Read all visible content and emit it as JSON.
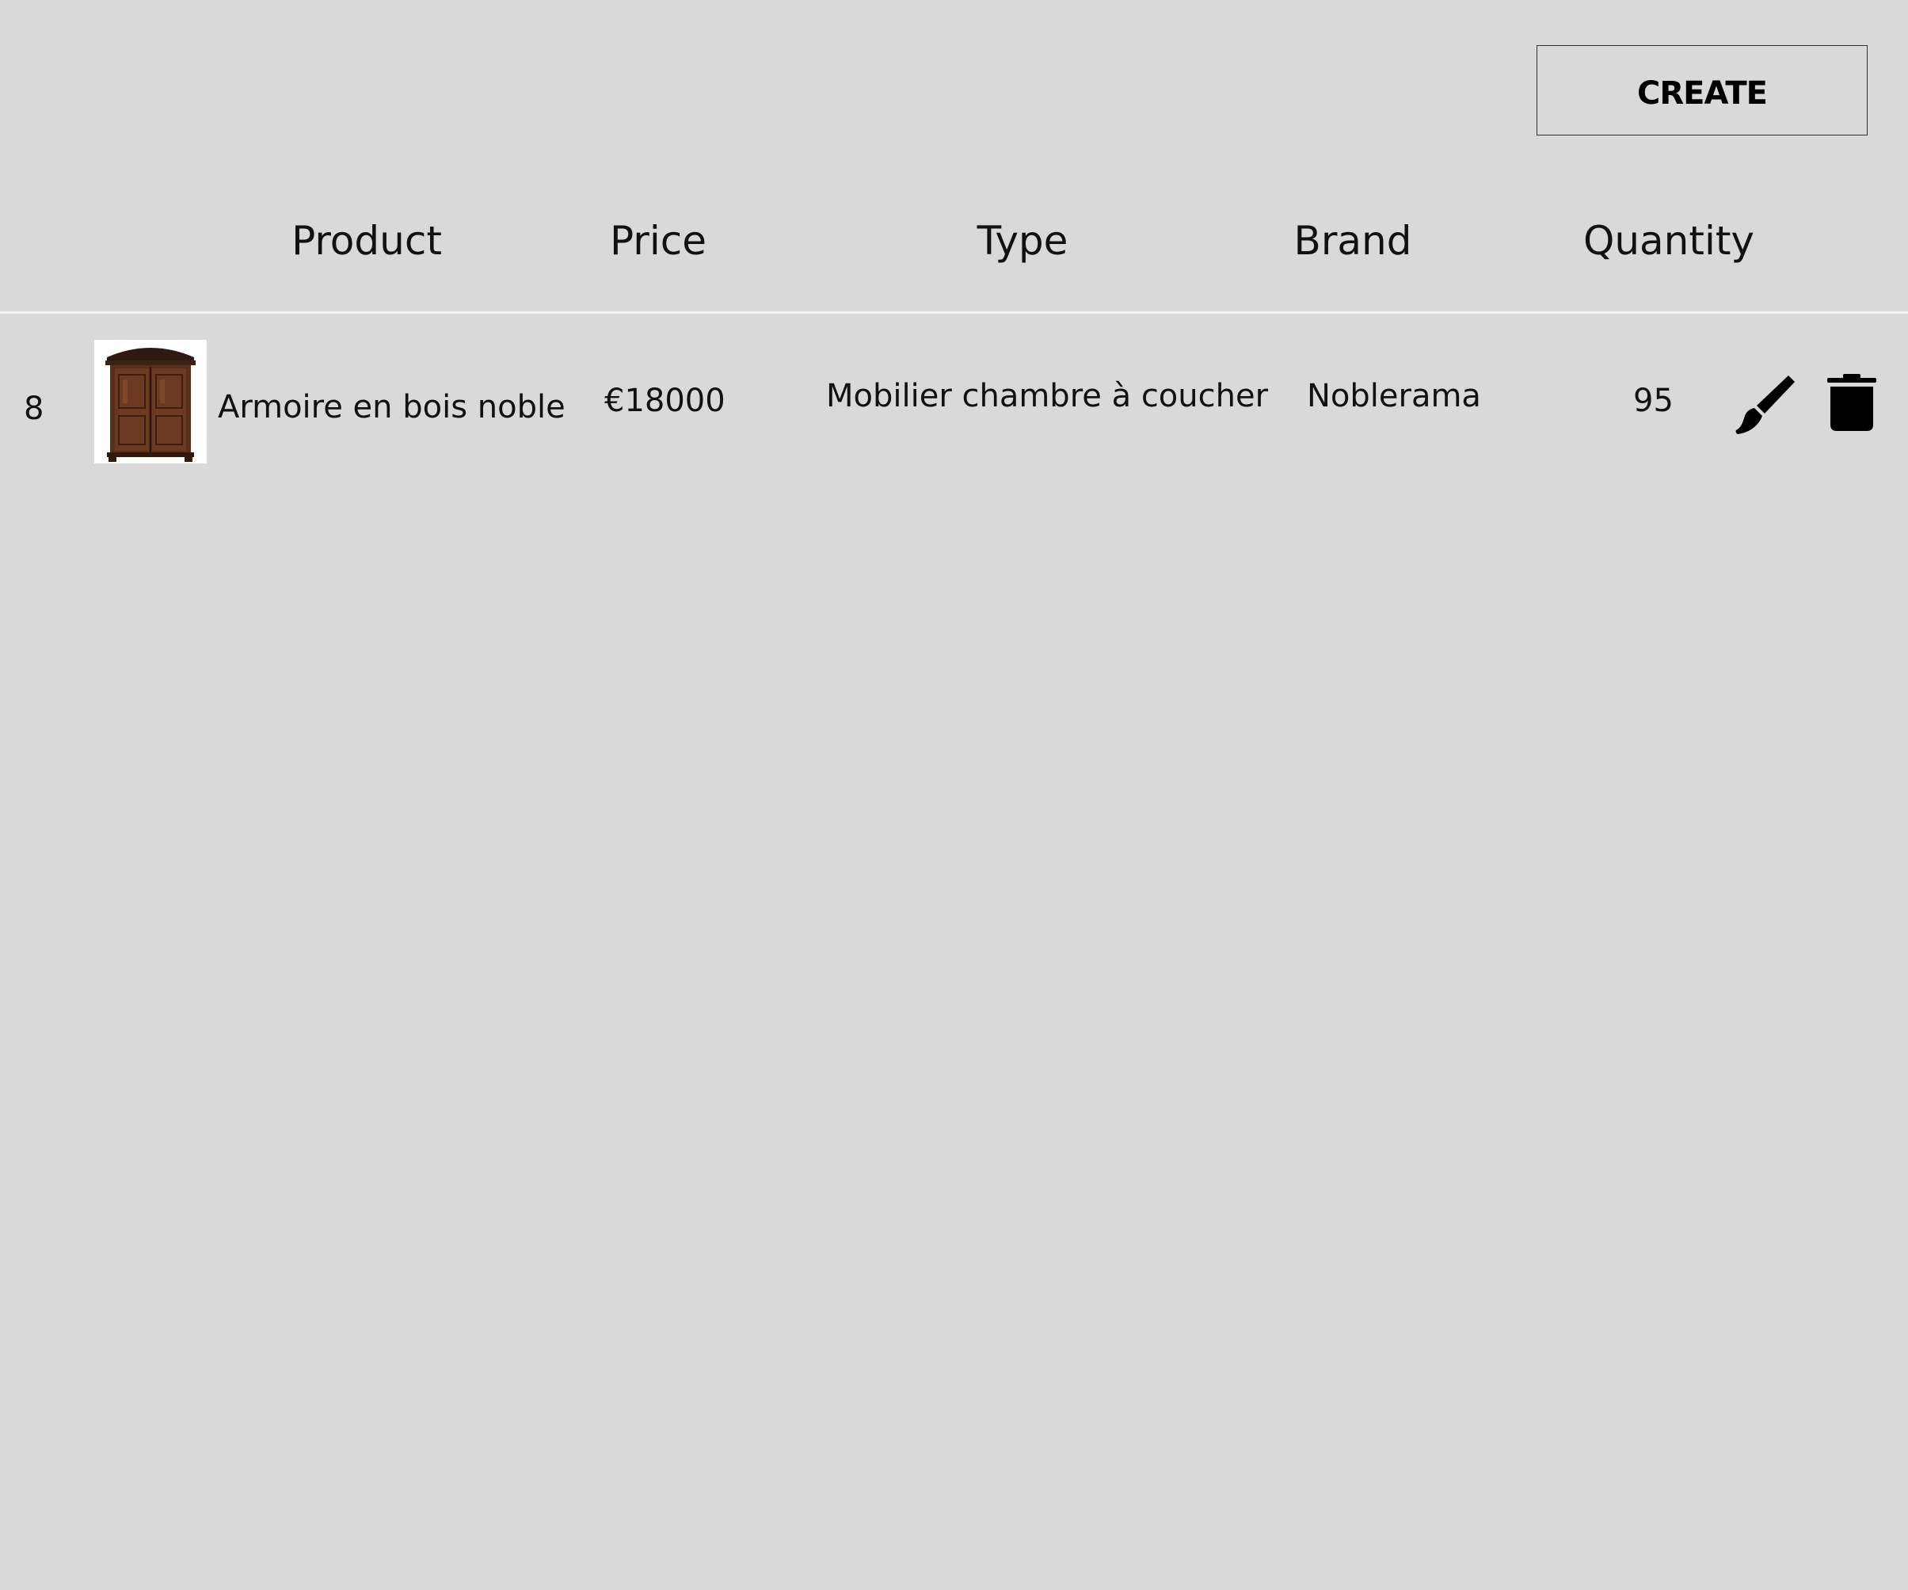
{
  "toolbar": {
    "create_label": "CREATE"
  },
  "table": {
    "columns": [
      "Product",
      "Price",
      "Type",
      "Brand",
      "Quantity"
    ],
    "rows": [
      {
        "id": "8",
        "product": "Armoire en bois noble",
        "price": "€18000",
        "type": "Mobilier chambre à coucher",
        "brand": "Noblerama",
        "quantity": "95",
        "image_icon": "wooden-armoire-image",
        "actions": [
          "edit-icon",
          "trash-icon"
        ]
      }
    ]
  },
  "colors": {
    "background": "#d9d9d9",
    "text": "#111111",
    "divider": "#f5f5f5"
  }
}
